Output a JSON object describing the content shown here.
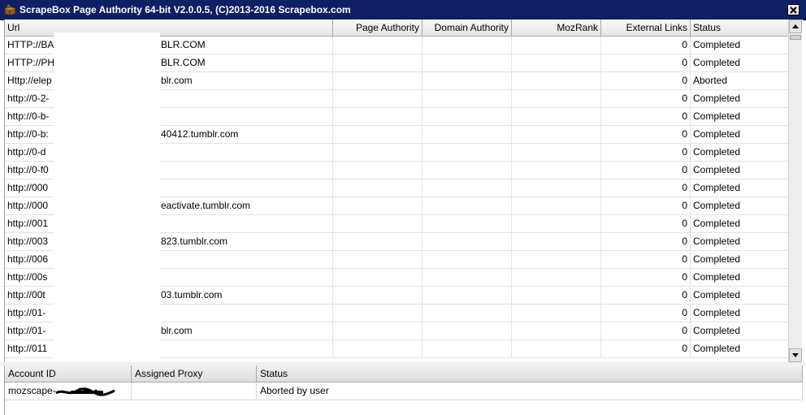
{
  "window": {
    "title": "ScrapeBox Page Authority 64-bit V2.0.0.5, (C)2013-2016 Scrapebox.com",
    "icon": "scrapebox-app-icon",
    "close_icon": "close-icon"
  },
  "results_grid": {
    "columns": {
      "url": "Url",
      "page_authority": "Page Authority",
      "domain_authority": "Domain Authority",
      "mozrank": "MozRank",
      "external_links": "External Links",
      "status": "Status"
    },
    "rows": [
      {
        "url": "HTTP://BA",
        "url_tail": "BLR.COM",
        "page_authority": "",
        "domain_authority": "",
        "mozrank": "",
        "external_links": "0",
        "status": "Completed"
      },
      {
        "url": "HTTP://PH",
        "url_tail": "BLR.COM",
        "page_authority": "",
        "domain_authority": "",
        "mozrank": "",
        "external_links": "0",
        "status": "Completed"
      },
      {
        "url": "Http://elep",
        "url_tail": "blr.com",
        "page_authority": "",
        "domain_authority": "",
        "mozrank": "",
        "external_links": "0",
        "status": "Aborted"
      },
      {
        "url": "http://0-2-",
        "url_tail": "",
        "page_authority": "",
        "domain_authority": "",
        "mozrank": "",
        "external_links": "0",
        "status": "Completed"
      },
      {
        "url": "http://0-b-",
        "url_tail": "",
        "page_authority": "",
        "domain_authority": "",
        "mozrank": "",
        "external_links": "0",
        "status": "Completed"
      },
      {
        "url": "http://0-b:",
        "url_tail": "40412.tumblr.com",
        "page_authority": "",
        "domain_authority": "",
        "mozrank": "",
        "external_links": "0",
        "status": "Completed"
      },
      {
        "url": "http://0-d",
        "url_tail": "",
        "page_authority": "",
        "domain_authority": "",
        "mozrank": "",
        "external_links": "0",
        "status": "Completed"
      },
      {
        "url": "http://0-f0",
        "url_tail": "",
        "page_authority": "",
        "domain_authority": "",
        "mozrank": "",
        "external_links": "0",
        "status": "Completed"
      },
      {
        "url": "http://000",
        "url_tail": "",
        "page_authority": "",
        "domain_authority": "",
        "mozrank": "",
        "external_links": "0",
        "status": "Completed"
      },
      {
        "url": "http://000",
        "url_tail": "eactivate.tumblr.com",
        "page_authority": "",
        "domain_authority": "",
        "mozrank": "",
        "external_links": "0",
        "status": "Completed"
      },
      {
        "url": "http://001",
        "url_tail": "",
        "page_authority": "",
        "domain_authority": "",
        "mozrank": "",
        "external_links": "0",
        "status": "Completed"
      },
      {
        "url": "http://003",
        "url_tail": "823.tumblr.com",
        "page_authority": "",
        "domain_authority": "",
        "mozrank": "",
        "external_links": "0",
        "status": "Completed"
      },
      {
        "url": "http://006",
        "url_tail": "",
        "page_authority": "",
        "domain_authority": "",
        "mozrank": "",
        "external_links": "0",
        "status": "Completed"
      },
      {
        "url": "http://00s",
        "url_tail": "",
        "page_authority": "",
        "domain_authority": "",
        "mozrank": "",
        "external_links": "0",
        "status": "Completed"
      },
      {
        "url": "http://00t",
        "url_tail": "03.tumblr.com",
        "page_authority": "",
        "domain_authority": "",
        "mozrank": "",
        "external_links": "0",
        "status": "Completed"
      },
      {
        "url": "http://01-",
        "url_tail": "",
        "page_authority": "",
        "domain_authority": "",
        "mozrank": "",
        "external_links": "0",
        "status": "Completed"
      },
      {
        "url": "http://01-",
        "url_tail": "blr.com",
        "page_authority": "",
        "domain_authority": "",
        "mozrank": "",
        "external_links": "0",
        "status": "Completed"
      },
      {
        "url": "http://011",
        "url_tail": "",
        "page_authority": "",
        "domain_authority": "",
        "mozrank": "",
        "external_links": "0",
        "status": "Completed"
      }
    ],
    "scrollbar": {
      "up_icon": "scroll-up-arrow-icon",
      "down_icon": "scroll-down-arrow-icon"
    }
  },
  "accounts_grid": {
    "columns": {
      "account_id": "Account ID",
      "assigned_proxy": "Assigned Proxy",
      "status": "Status"
    },
    "rows": [
      {
        "account_id": "mozscape-",
        "assigned_proxy": "",
        "status": "Aborted by user"
      }
    ]
  },
  "colors": {
    "title_bar": "#0e1f63",
    "title_text": "#ffffff",
    "grid_line": "#e2e2e2",
    "header_bg": "#ececec"
  }
}
